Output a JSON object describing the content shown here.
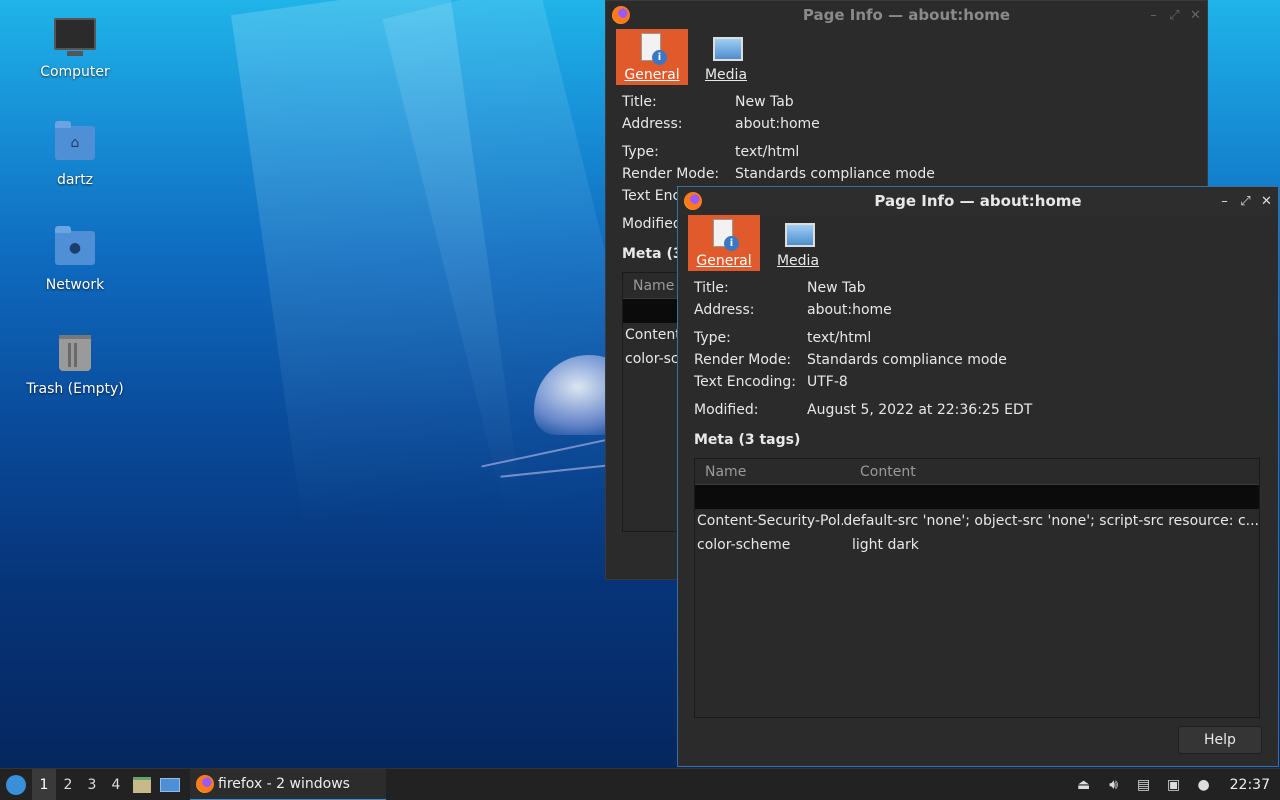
{
  "desktop": {
    "icons": [
      {
        "label": "Computer",
        "icon": "computer-icon"
      },
      {
        "label": "dartz",
        "icon": "home-folder-icon"
      },
      {
        "label": "Network",
        "icon": "network-folder-icon"
      },
      {
        "label": "Trash (Empty)",
        "icon": "trash-icon"
      }
    ]
  },
  "window_back": {
    "title": "Page Info — about:home",
    "tabs": [
      "General",
      "Media"
    ],
    "fields": [
      {
        "key": "Title:",
        "value": "New Tab"
      },
      {
        "key": "Address:",
        "value": "about:home"
      },
      {
        "key": "Type:",
        "value": "text/html"
      },
      {
        "key": "Render Mode:",
        "value": "Standards compliance mode"
      },
      {
        "key": "Text Enco",
        "value": ""
      },
      {
        "key": "Modified",
        "value": ""
      }
    ],
    "meta_heading": "Meta (3",
    "col_name": "Name",
    "rows": [
      "Content",
      "color-sc"
    ]
  },
  "window_front": {
    "title": "Page Info — about:home",
    "tabs": {
      "general": "General",
      "media": "Media"
    },
    "fields": {
      "title_k": "Title:",
      "title_v": "New Tab",
      "address_k": "Address:",
      "address_v": "about:home",
      "type_k": "Type:",
      "type_v": "text/html",
      "render_k": "Render Mode:",
      "render_v": "Standards compliance mode",
      "enc_k": "Text Encoding:",
      "enc_v": "UTF-8",
      "mod_k": "Modified:",
      "mod_v": "August 5, 2022 at 22:36:25 EDT"
    },
    "meta_heading": "Meta (3 tags)",
    "columns": {
      "name": "Name",
      "content": "Content"
    },
    "rows": [
      {
        "name": "Content-Security-Pol...",
        "content": "default-src 'none'; object-src 'none'; script-src resource: c..."
      },
      {
        "name": "color-scheme",
        "content": "light dark"
      }
    ],
    "help": "Help"
  },
  "taskbar": {
    "workspaces": [
      "1",
      "2",
      "3",
      "4"
    ],
    "active_workspace": "1",
    "task_label": "firefox - 2 windows",
    "clock": "22:37"
  },
  "colors": {
    "accent": "#e05a2b",
    "active_border": "#3c6e9e",
    "window_bg": "#2b2b2b"
  }
}
